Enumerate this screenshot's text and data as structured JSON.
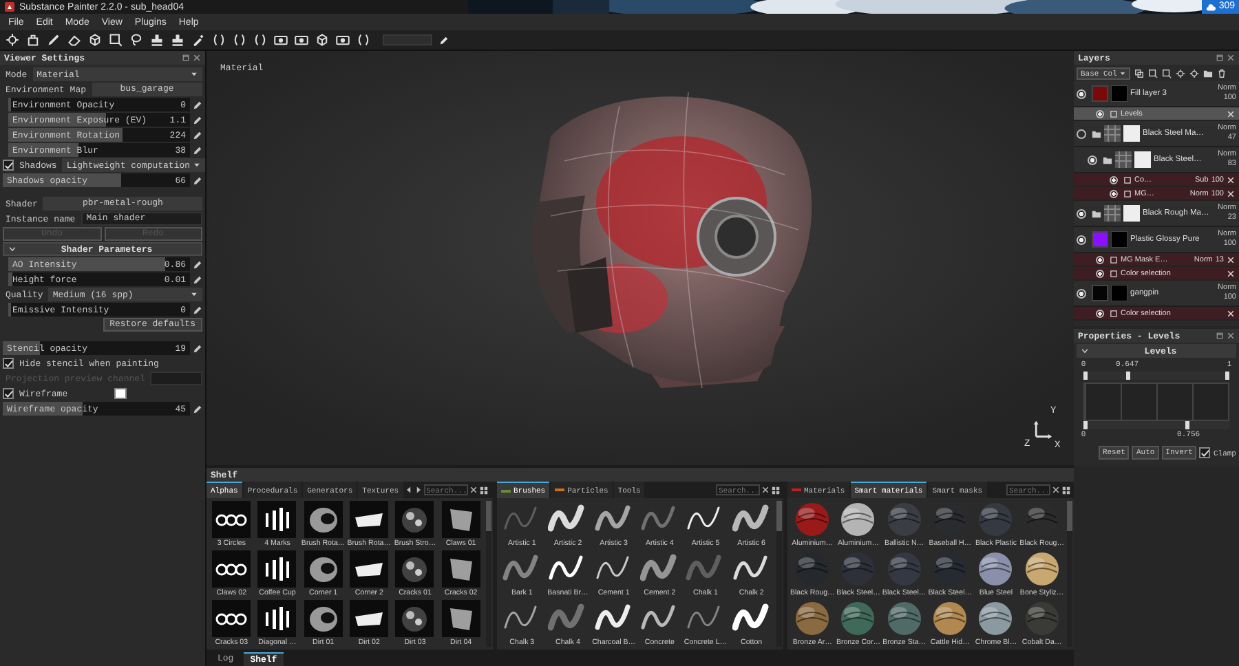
{
  "window": {
    "title": "Substance Painter 2.2.0 - sub_head04"
  },
  "badge": "309",
  "menu": [
    "File",
    "Edit",
    "Mode",
    "View",
    "Plugins",
    "Help"
  ],
  "viewer_settings": {
    "title": "Viewer Settings",
    "rows": [
      {
        "kind": "select",
        "label": "Mode",
        "value": "Material"
      },
      {
        "kind": "map",
        "label": "Environment Map",
        "value": "bus_garage"
      },
      {
        "kind": "slider",
        "label": "Environment Opacity",
        "value": "0",
        "level": 0.0
      },
      {
        "kind": "slider",
        "label": "Environment Exposure (EV)",
        "value": "1.1",
        "level": 0.53
      },
      {
        "kind": "slider",
        "label": "Environment Rotation",
        "value": "224",
        "level": 0.62
      },
      {
        "kind": "slider",
        "label": "Environment Blur",
        "value": "38",
        "level": 0.38
      },
      {
        "kind": "check-select",
        "label": "Shadows",
        "checked": true,
        "value": "Lightweight computation"
      },
      {
        "kind": "slider",
        "label": "Shadows opacity",
        "value": "66",
        "level": 0.63
      },
      {
        "kind": "map",
        "label": "Shader",
        "value": "pbr-metal-rough"
      },
      {
        "kind": "field",
        "label": "Instance name",
        "value": "Main shader"
      },
      {
        "kind": "buttons",
        "buttons": [
          {
            "label": "Undo",
            "disabled": true
          },
          {
            "label": "Redo",
            "disabled": true
          }
        ]
      },
      {
        "kind": "section",
        "label": "Shader Parameters",
        "expanded": true
      },
      {
        "kind": "slider",
        "label": "AO Intensity",
        "value": "0.86",
        "level": 0.86
      },
      {
        "kind": "slider",
        "label": "Height force",
        "value": "0.01",
        "level": 0.01
      },
      {
        "kind": "select",
        "label": "Quality",
        "value": "Medium (16 spp)"
      },
      {
        "kind": "slider",
        "label": "Emissive Intensity",
        "value": "0",
        "level": 0.0
      },
      {
        "kind": "button",
        "label": "Restore defaults"
      },
      {
        "kind": "slider",
        "label": "Stencil opacity",
        "value": "19",
        "level": 0.19
      },
      {
        "kind": "check",
        "label": "Hide stencil when painting",
        "checked": true
      },
      {
        "kind": "disabled-field",
        "label": "Projection preview channel",
        "disabled": true
      },
      {
        "kind": "check-color",
        "label": "Wireframe",
        "checked": true,
        "color": "#ffffff"
      },
      {
        "kind": "slider",
        "label": "Wireframe opacity",
        "value": "45",
        "level": 0.42
      }
    ]
  },
  "viewport": {
    "label": "Material",
    "axes": [
      "Y",
      "Z",
      "X"
    ]
  },
  "layers": {
    "title": "Layers",
    "blend": "Base Col",
    "rows": [
      {
        "kind": "fill",
        "name": "Fill layer 3",
        "blend": "Norm",
        "opacity": "100",
        "visible": true,
        "selected": false,
        "color": "#7a0a0a",
        "children": [
          {
            "kind": "effect",
            "name": "Levels",
            "visible": true,
            "selected": true
          }
        ]
      },
      {
        "kind": "folder",
        "name": "Black Steel Ma…",
        "blend": "Norm",
        "opacity": "47",
        "visible": false,
        "selected": false,
        "children": [
          {
            "kind": "folder",
            "name": "Black Steel…",
            "blend": "Norm",
            "opacity": "83",
            "visible": true,
            "selected": false,
            "children": [
              {
                "kind": "effect",
                "name": "Co…",
                "blend": "Sub",
                "opacity": "100",
                "visible": true,
                "selected": false
              },
              {
                "kind": "effect",
                "name": "MG…",
                "blend": "Norm",
                "opacity": "100",
                "visible": true,
                "selected": false
              }
            ]
          }
        ]
      },
      {
        "kind": "folder",
        "name": "Black Rough Ma…",
        "blend": "Norm",
        "opacity": "23",
        "visible": true,
        "selected": false
      },
      {
        "kind": "fill",
        "name": "Plastic Glossy Pure",
        "blend": "Norm",
        "opacity": "100",
        "visible": true,
        "selected": false,
        "color": "#8a10ff",
        "children": [
          {
            "kind": "effect",
            "name": "MG Mask E…",
            "blend": "Norm",
            "opacity": "13",
            "visible": true,
            "selected": false
          },
          {
            "kind": "effect",
            "name": "Color selection",
            "visible": true,
            "selected": false
          }
        ]
      },
      {
        "kind": "fill",
        "name": "gangpin",
        "blend": "Norm",
        "opacity": "100",
        "visible": true,
        "selected": false,
        "color": "#050505",
        "children": [
          {
            "kind": "effect",
            "name": "Color selection",
            "visible": true,
            "selected": false
          }
        ]
      }
    ]
  },
  "properties": {
    "title": "Properties - Levels",
    "section": "Levels",
    "expanded": true,
    "input_handles": [
      {
        "label": "0",
        "level": 0
      },
      {
        "label": "0.647",
        "level": 0.3
      },
      {
        "label": "1",
        "level": 1
      }
    ],
    "output_handles": [
      {
        "label": "0",
        "level": 0
      },
      {
        "label": "0.756",
        "level": 0.72
      }
    ],
    "buttons": [
      "Reset",
      "Auto",
      "Invert"
    ],
    "clamp": {
      "label": "Clamp",
      "checked": true
    }
  },
  "shelf": {
    "title": "Shelf",
    "panes": [
      {
        "kind": "alpha",
        "tabs": [
          {
            "label": "Alphas",
            "selected": true
          },
          {
            "label": "Procedurals",
            "selected": false
          },
          {
            "label": "Generators",
            "selected": false
          },
          {
            "label": "Textures",
            "selected": false
          }
        ],
        "search": {
          "placeholder": "Search..."
        },
        "items": [
          "3 Circles",
          "4 Marks",
          "Brush Rota…",
          "Brush Rota…",
          "Brush Stro…",
          "Claws 01",
          "Claws 02",
          "Coffee Cup",
          "Corner 1",
          "Corner 2",
          "Cracks 01",
          "Cracks 02",
          "Cracks 03",
          "Diagonal …",
          "Dirt 01",
          "Dirt 02",
          "Dirt 03",
          "Dirt 04"
        ]
      },
      {
        "kind": "brush",
        "tabs": [
          {
            "label": "Brushes",
            "selected": true,
            "color": "#6a8a3a"
          },
          {
            "label": "Particles",
            "selected": false,
            "color": "#c8701a"
          },
          {
            "label": "Tools",
            "selected": false
          }
        ],
        "search": {
          "placeholder": "Search..."
        },
        "items": [
          "Artistic 1",
          "Artistic 2",
          "Artistic 3",
          "Artistic 4",
          "Artistic 5",
          "Artistic 6",
          "Bark 1",
          "Basnati Br…",
          "Cement 1",
          "Cement 2",
          "Chalk 1",
          "Chalk 2",
          "Chalk 3",
          "Chalk 4",
          "Charcoal B…",
          "Concrete",
          "Concrete L…",
          "Cotton"
        ]
      },
      {
        "kind": "material",
        "tabs": [
          {
            "label": "Materials",
            "selected": false,
            "color": "#c02020"
          },
          {
            "label": "Smart materials",
            "selected": true
          },
          {
            "label": "Smart masks",
            "selected": false
          }
        ],
        "search": {
          "placeholder": "Search..."
        },
        "items": [
          {
            "label": "Aluminium…",
            "color": "#9a1a1a"
          },
          {
            "label": "Aluminium…",
            "color": "#b4b4b4"
          },
          {
            "label": "Ballistic N…",
            "color": "#3a3d44"
          },
          {
            "label": "Baseball H…",
            "color": "#2a2b2e"
          },
          {
            "label": "Black Plastic",
            "color": "#353a42"
          },
          {
            "label": "Black Roug…",
            "color": "#2b2b2b"
          },
          {
            "label": "Black Roug…",
            "color": "#25282c"
          },
          {
            "label": "Black Steel…",
            "color": "#2d3038"
          },
          {
            "label": "Black Steel…",
            "color": "#343842"
          },
          {
            "label": "Black Steel…",
            "color": "#262a32"
          },
          {
            "label": "Blue Steel",
            "color": "#8a90aa"
          },
          {
            "label": "Bone Styliz…",
            "color": "#c8a870"
          },
          {
            "label": "Bronze Ar…",
            "color": "#8a6a40"
          },
          {
            "label": "Bronze Cor…",
            "color": "#3f6a5a"
          },
          {
            "label": "Bronze Sta…",
            "color": "#506a68"
          },
          {
            "label": "Cattle Hid…",
            "color": "#b08850"
          },
          {
            "label": "Chrome Bl…",
            "color": "#8a9aa0"
          },
          {
            "label": "Cobalt Da…",
            "color": "#3a3a36"
          }
        ]
      }
    ]
  },
  "bottom_tabs": [
    {
      "label": "Log",
      "selected": false
    },
    {
      "label": "Shelf",
      "selected": true
    }
  ]
}
